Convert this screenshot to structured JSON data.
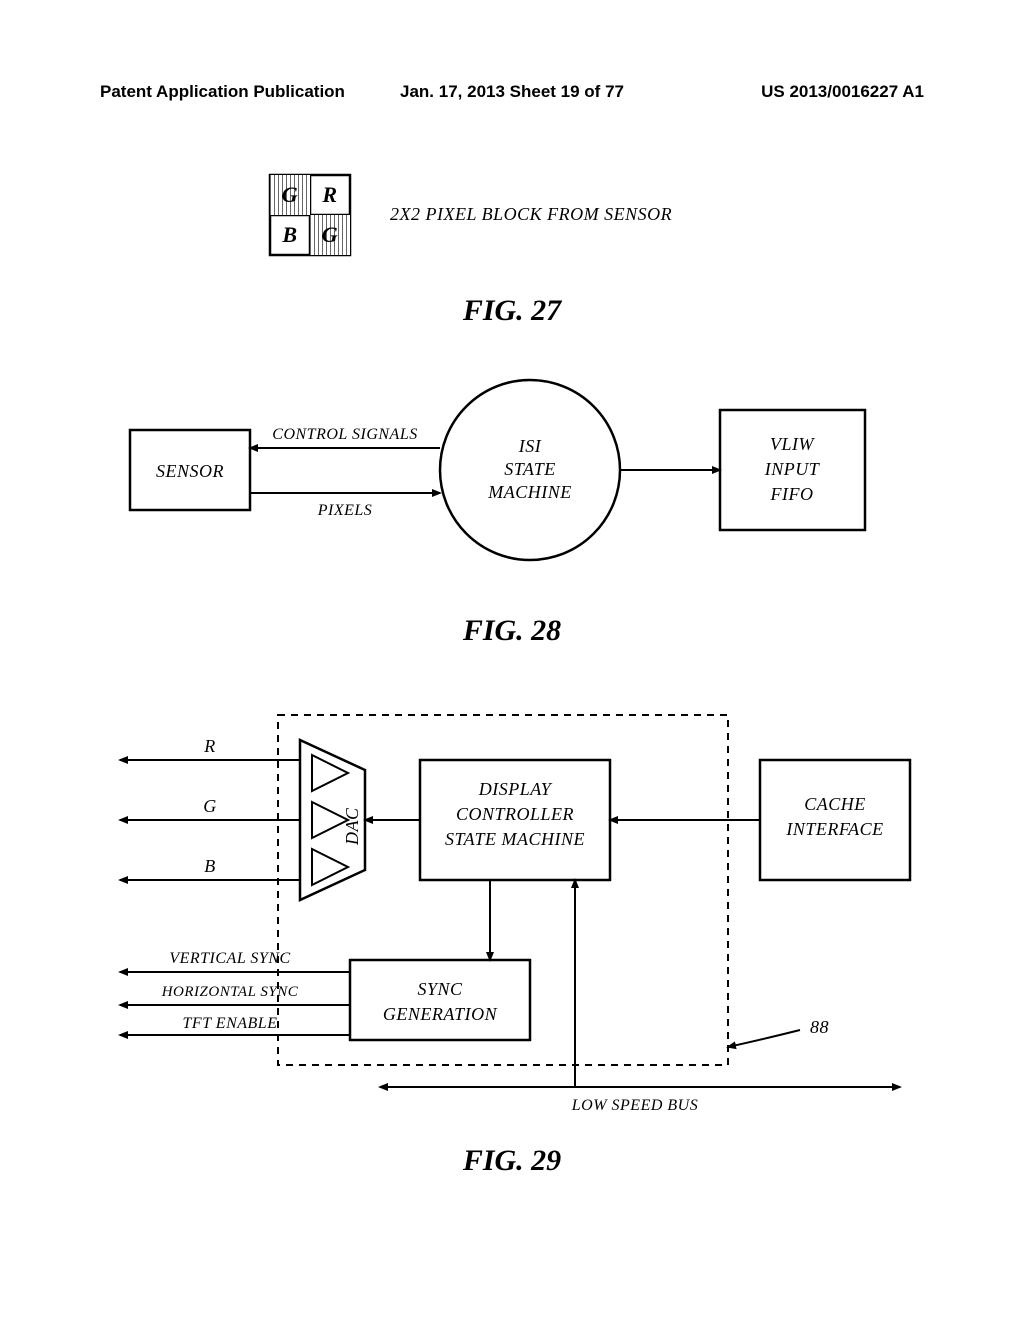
{
  "header": {
    "left": "Patent Application Publication",
    "center": "Jan. 17, 2013  Sheet 19 of 77",
    "right": "US 2013/0016227 A1"
  },
  "fig27": {
    "grid": {
      "tl": "G",
      "tr": "R",
      "bl": "B",
      "br": "G"
    },
    "label": "2X2 PIXEL BLOCK FROM SENSOR",
    "caption": "FIG. 27"
  },
  "fig28": {
    "sensor": "SENSOR",
    "control_signals": "CONTROL SIGNALS",
    "pixels": "PIXELS",
    "isi_line1": "ISI",
    "isi_line2": "STATE",
    "isi_line3": "MACHINE",
    "vliw_line1": "VLIW",
    "vliw_line2": "INPUT",
    "vliw_line3": "FIFO",
    "caption": "FIG. 28"
  },
  "fig29": {
    "R": "R",
    "G": "G",
    "B": "B",
    "vsync": "VERTICAL SYNC",
    "hsync": "HORIZONTAL SYNC",
    "tft": "TFT ENABLE",
    "dac": "DAC",
    "dcsm_line1": "DISPLAY",
    "dcsm_line2": "CONTROLLER",
    "dcsm_line3": "STATE MACHINE",
    "cache_line1": "CACHE",
    "cache_line2": "INTERFACE",
    "sync_line1": "SYNC",
    "sync_line2": "GENERATION",
    "ref88": "88",
    "bus": "LOW SPEED BUS",
    "caption": "FIG. 29"
  }
}
